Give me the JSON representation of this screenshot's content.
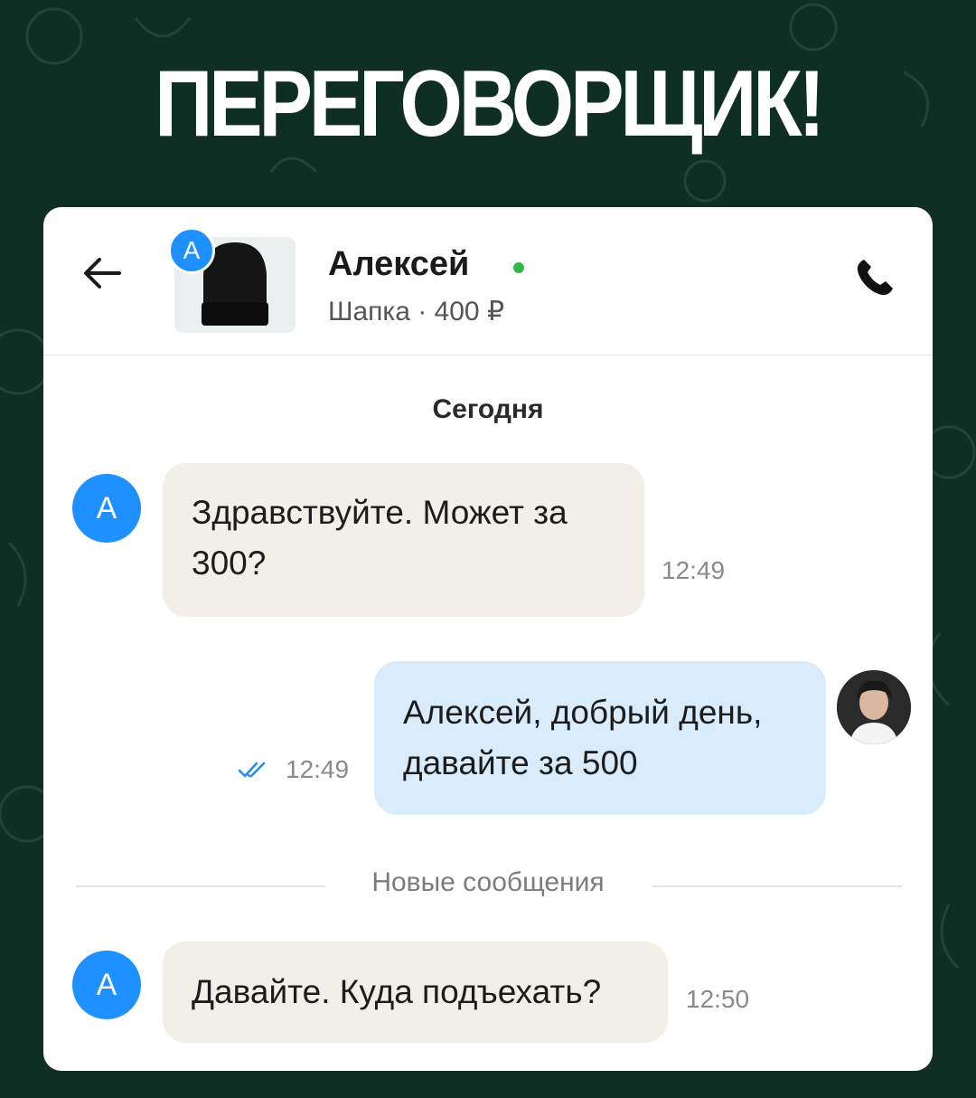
{
  "headline": "ПЕРЕГОВОРЩИК!",
  "chat": {
    "contact_initial": "А",
    "contact_name": "Алексей",
    "listing": "Шапка · 400 ₽",
    "date_separator": "Сегодня",
    "new_messages_separator": "Новые сообщения",
    "online_color": "#2fba46",
    "messages": [
      {
        "direction": "incoming",
        "text_lines": [
          "Здравствуйте. Может за",
          "300?"
        ],
        "time": "12:49",
        "avatar": "А"
      },
      {
        "direction": "outgoing",
        "text_lines": [
          "Алексей, добрый день,",
          "давайте за 500"
        ],
        "time": "12:49",
        "read": true
      },
      {
        "direction": "incoming",
        "text_lines": [
          "Давайте. Куда подъехать?"
        ],
        "time": "12:50",
        "avatar": "А"
      }
    ]
  },
  "colors": {
    "background": "#0f2e24",
    "incoming_bubble": "#f1efe8",
    "outgoing_bubble": "#d9ecfb",
    "avatar": "#1e90ff",
    "read_check": "#2f8be8"
  },
  "icons": [
    "back-arrow-icon",
    "phone-icon",
    "double-check-icon"
  ]
}
